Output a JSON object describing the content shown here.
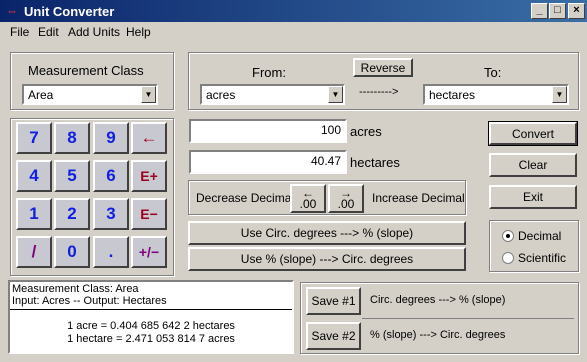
{
  "window": {
    "title": "Unit Converter",
    "icon": "unit-converter-icon",
    "controls": {
      "minimize": "_",
      "maximize": "□",
      "close": "×"
    }
  },
  "menu": {
    "file": "File",
    "edit": "Edit",
    "add_units": "Add Units",
    "help": "Help"
  },
  "measurement_class": {
    "label": "Measurement Class",
    "value": "Area"
  },
  "from_to": {
    "from_label": "From:",
    "to_label": "To:",
    "reverse_label": "Reverse",
    "from_value": "acres",
    "to_value": "hectares",
    "arrow_text": "--------->"
  },
  "keypad": {
    "keys": [
      "7",
      "8",
      "9",
      "←",
      "4",
      "5",
      "6",
      "E+",
      "1",
      "2",
      "3",
      "E−",
      "/",
      "0",
      ".",
      "+/−"
    ]
  },
  "input": {
    "value": "100",
    "unit": "acres"
  },
  "output": {
    "value": "40.47",
    "unit": "hectares"
  },
  "actions": {
    "convert": "Convert",
    "clear": "Clear",
    "exit": "Exit"
  },
  "decimal": {
    "decrease_label": "Decrease Decimal",
    "increase_label": "Increase Decimal",
    "decrease_btn_top": "←",
    "decrease_btn_bottom": ".00",
    "increase_btn_top": "→",
    "increase_btn_bottom": ".00"
  },
  "slope": {
    "to_slope": "Use Circ. degrees ---> % (slope)",
    "to_degrees": "Use % (slope) ---> Circ. degrees"
  },
  "format": {
    "decimal": "Decimal",
    "scientific": "Scientific",
    "selected": "decimal"
  },
  "info": {
    "line1": "Measurement Class:  Area",
    "line2": "Input:  Acres -- Output:  Hectares",
    "result1": "1 acre = 0.404 685 642 2 hectares",
    "result2": "1 hectare = 2.471 053 814 7 acres"
  },
  "saves": {
    "save1_label": "Save #1",
    "save1_text": "Circ. degrees ---> % (slope)",
    "save2_label": "Save #2",
    "save2_text": "% (slope) ---> Circ. degrees"
  }
}
